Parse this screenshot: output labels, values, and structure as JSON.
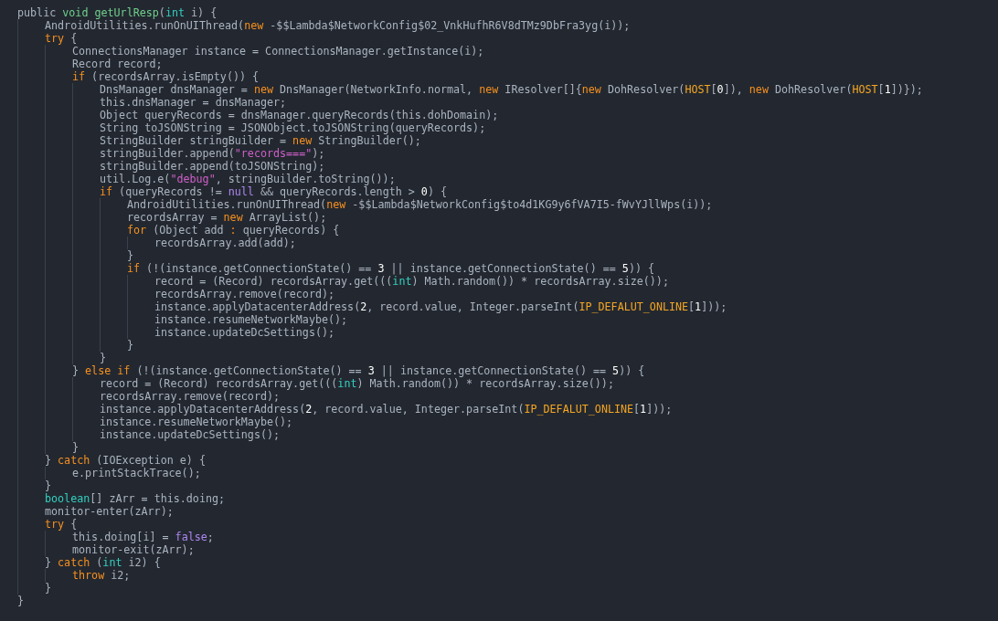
{
  "editor": {
    "lines": [
      {
        "tokens": [
          {
            "kind": "plain",
            "text": "public "
          },
          {
            "kind": "function",
            "text": "void getUrlResp"
          },
          {
            "kind": "plain",
            "text": "("
          },
          {
            "kind": "type",
            "text": "int"
          },
          {
            "kind": "plain",
            "text": " i) {"
          }
        ],
        "children": [
          {
            "tokens": [
              {
                "kind": "plain",
                "text": "AndroidUtilities.runOnUIThread("
              },
              {
                "kind": "keyword",
                "text": "new"
              },
              {
                "kind": "plain",
                "text": " -$$Lambda$NetworkConfig$02_VnkHufhR6V8dTMz9DbFra3yg(i));"
              }
            ]
          },
          {
            "tokens": [
              {
                "kind": "keyword",
                "text": "try"
              },
              {
                "kind": "plain",
                "text": " {"
              }
            ],
            "children": [
              {
                "tokens": [
                  {
                    "kind": "plain",
                    "text": "ConnectionsManager instance = ConnectionsManager.getInstance(i);"
                  }
                ]
              },
              {
                "tokens": [
                  {
                    "kind": "plain",
                    "text": "Record record;"
                  }
                ]
              },
              {
                "tokens": [
                  {
                    "kind": "keyword",
                    "text": "if"
                  },
                  {
                    "kind": "plain",
                    "text": " (recordsArray.isEmpty()) {"
                  }
                ],
                "children": [
                  {
                    "tokens": [
                      {
                        "kind": "plain",
                        "text": "DnsManager dnsManager = "
                      },
                      {
                        "kind": "keyword",
                        "text": "new"
                      },
                      {
                        "kind": "plain",
                        "text": " DnsManager(NetworkInfo.normal, "
                      },
                      {
                        "kind": "keyword",
                        "text": "new"
                      },
                      {
                        "kind": "plain",
                        "text": " IResolver[]{"
                      },
                      {
                        "kind": "keyword",
                        "text": "new"
                      },
                      {
                        "kind": "plain",
                        "text": " DohResolver("
                      },
                      {
                        "kind": "constant",
                        "text": "HOST"
                      },
                      {
                        "kind": "plain",
                        "text": "["
                      },
                      {
                        "kind": "number",
                        "text": "0"
                      },
                      {
                        "kind": "plain",
                        "text": "]), "
                      },
                      {
                        "kind": "keyword",
                        "text": "new"
                      },
                      {
                        "kind": "plain",
                        "text": " DohResolver("
                      },
                      {
                        "kind": "constant",
                        "text": "HOST"
                      },
                      {
                        "kind": "plain",
                        "text": "["
                      },
                      {
                        "kind": "number",
                        "text": "1"
                      },
                      {
                        "kind": "plain",
                        "text": "])});"
                      }
                    ]
                  },
                  {
                    "tokens": [
                      {
                        "kind": "plain",
                        "text": "this.dnsManager = dnsManager;"
                      }
                    ]
                  },
                  {
                    "tokens": [
                      {
                        "kind": "plain",
                        "text": "Object queryRecords = dnsManager.queryRecords(this.dohDomain);"
                      }
                    ]
                  },
                  {
                    "tokens": [
                      {
                        "kind": "plain",
                        "text": "String toJSONString = JSONObject.toJSONString(queryRecords);"
                      }
                    ]
                  },
                  {
                    "tokens": [
                      {
                        "kind": "plain",
                        "text": "StringBuilder stringBuilder = "
                      },
                      {
                        "kind": "keyword",
                        "text": "new"
                      },
                      {
                        "kind": "plain",
                        "text": " StringBuilder();"
                      }
                    ]
                  },
                  {
                    "tokens": [
                      {
                        "kind": "plain",
                        "text": "stringBuilder.append("
                      },
                      {
                        "kind": "string",
                        "text": "\"records===\""
                      },
                      {
                        "kind": "plain",
                        "text": ");"
                      }
                    ]
                  },
                  {
                    "tokens": [
                      {
                        "kind": "plain",
                        "text": "stringBuilder.append(toJSONString);"
                      }
                    ]
                  },
                  {
                    "tokens": [
                      {
                        "kind": "plain",
                        "text": "util.Log.e("
                      },
                      {
                        "kind": "string",
                        "text": "\"debug\""
                      },
                      {
                        "kind": "plain",
                        "text": ", stringBuilder.toString());"
                      }
                    ]
                  },
                  {
                    "tokens": [
                      {
                        "kind": "keyword",
                        "text": "if"
                      },
                      {
                        "kind": "plain",
                        "text": " (queryRecords != "
                      },
                      {
                        "kind": "literal",
                        "text": "null"
                      },
                      {
                        "kind": "plain",
                        "text": " && queryRecords.length > "
                      },
                      {
                        "kind": "number",
                        "text": "0"
                      },
                      {
                        "kind": "plain",
                        "text": ") {"
                      }
                    ],
                    "children": [
                      {
                        "tokens": [
                          {
                            "kind": "plain",
                            "text": "AndroidUtilities.runOnUIThread("
                          },
                          {
                            "kind": "keyword",
                            "text": "new"
                          },
                          {
                            "kind": "plain",
                            "text": " -$$Lambda$NetworkConfig$to4d1KG9y6fVA7I5-fWvYJllWps(i));"
                          }
                        ]
                      },
                      {
                        "tokens": [
                          {
                            "kind": "plain",
                            "text": "recordsArray = "
                          },
                          {
                            "kind": "keyword",
                            "text": "new"
                          },
                          {
                            "kind": "plain",
                            "text": " ArrayList();"
                          }
                        ]
                      },
                      {
                        "tokens": [
                          {
                            "kind": "keyword",
                            "text": "for"
                          },
                          {
                            "kind": "plain",
                            "text": " (Object add "
                          },
                          {
                            "kind": "keyword",
                            "text": ":"
                          },
                          {
                            "kind": "plain",
                            "text": " queryRecords) {"
                          }
                        ],
                        "children": [
                          {
                            "tokens": [
                              {
                                "kind": "plain",
                                "text": "recordsArray.add(add);"
                              }
                            ]
                          }
                        ]
                      },
                      {
                        "tokens": [
                          {
                            "kind": "plain",
                            "text": "}"
                          }
                        ]
                      },
                      {
                        "tokens": [
                          {
                            "kind": "keyword",
                            "text": "if"
                          },
                          {
                            "kind": "plain",
                            "text": " (!(instance.getConnectionState() == "
                          },
                          {
                            "kind": "number",
                            "text": "3"
                          },
                          {
                            "kind": "plain",
                            "text": " || instance.getConnectionState() == "
                          },
                          {
                            "kind": "number",
                            "text": "5"
                          },
                          {
                            "kind": "plain",
                            "text": ")) {"
                          }
                        ],
                        "children": [
                          {
                            "tokens": [
                              {
                                "kind": "plain",
                                "text": "record = (Record) recordsArray.get((("
                              },
                              {
                                "kind": "type",
                                "text": "int"
                              },
                              {
                                "kind": "plain",
                                "text": ") Math.random()) * recordsArray.size());"
                              }
                            ]
                          },
                          {
                            "tokens": [
                              {
                                "kind": "plain",
                                "text": "recordsArray.remove(record);"
                              }
                            ]
                          },
                          {
                            "tokens": [
                              {
                                "kind": "plain",
                                "text": "instance.applyDatacenterAddress("
                              },
                              {
                                "kind": "number",
                                "text": "2"
                              },
                              {
                                "kind": "plain",
                                "text": ", record.value, Integer.parseInt("
                              },
                              {
                                "kind": "constant",
                                "text": "IP_DEFALUT_ONLINE"
                              },
                              {
                                "kind": "plain",
                                "text": "["
                              },
                              {
                                "kind": "number",
                                "text": "1"
                              },
                              {
                                "kind": "plain",
                                "text": "]));"
                              }
                            ]
                          },
                          {
                            "tokens": [
                              {
                                "kind": "plain",
                                "text": "instance.resumeNetworkMaybe();"
                              }
                            ]
                          },
                          {
                            "tokens": [
                              {
                                "kind": "plain",
                                "text": "instance.updateDcSettings();"
                              }
                            ]
                          }
                        ]
                      },
                      {
                        "tokens": [
                          {
                            "kind": "plain",
                            "text": "}"
                          }
                        ]
                      }
                    ]
                  },
                  {
                    "tokens": [
                      {
                        "kind": "plain",
                        "text": "}"
                      }
                    ]
                  }
                ]
              },
              {
                "tokens": [
                  {
                    "kind": "plain",
                    "text": "} "
                  },
                  {
                    "kind": "keyword",
                    "text": "else if"
                  },
                  {
                    "kind": "plain",
                    "text": " (!(instance.getConnectionState() == "
                  },
                  {
                    "kind": "number",
                    "text": "3"
                  },
                  {
                    "kind": "plain",
                    "text": " || instance.getConnectionState() == "
                  },
                  {
                    "kind": "number",
                    "text": "5"
                  },
                  {
                    "kind": "plain",
                    "text": ")) {"
                  }
                ],
                "children": [
                  {
                    "tokens": [
                      {
                        "kind": "plain",
                        "text": "record = (Record) recordsArray.get((("
                      },
                      {
                        "kind": "type",
                        "text": "int"
                      },
                      {
                        "kind": "plain",
                        "text": ") Math.random()) * recordsArray.size());"
                      }
                    ]
                  },
                  {
                    "tokens": [
                      {
                        "kind": "plain",
                        "text": "recordsArray.remove(record);"
                      }
                    ]
                  },
                  {
                    "tokens": [
                      {
                        "kind": "plain",
                        "text": "instance.applyDatacenterAddress("
                      },
                      {
                        "kind": "number",
                        "text": "2"
                      },
                      {
                        "kind": "plain",
                        "text": ", record.value, Integer.parseInt("
                      },
                      {
                        "kind": "constant",
                        "text": "IP_DEFALUT_ONLINE"
                      },
                      {
                        "kind": "plain",
                        "text": "["
                      },
                      {
                        "kind": "number",
                        "text": "1"
                      },
                      {
                        "kind": "plain",
                        "text": "]));"
                      }
                    ]
                  },
                  {
                    "tokens": [
                      {
                        "kind": "plain",
                        "text": "instance.resumeNetworkMaybe();"
                      }
                    ]
                  },
                  {
                    "tokens": [
                      {
                        "kind": "plain",
                        "text": "instance.updateDcSettings();"
                      }
                    ]
                  }
                ]
              },
              {
                "tokens": [
                  {
                    "kind": "plain",
                    "text": "}"
                  }
                ]
              }
            ]
          },
          {
            "tokens": [
              {
                "kind": "plain",
                "text": "} "
              },
              {
                "kind": "keyword",
                "text": "catch"
              },
              {
                "kind": "plain",
                "text": " (IOException e) {"
              }
            ],
            "children": [
              {
                "tokens": [
                  {
                    "kind": "plain",
                    "text": "e.printStackTrace();"
                  }
                ]
              }
            ]
          },
          {
            "tokens": [
              {
                "kind": "plain",
                "text": "}"
              }
            ]
          },
          {
            "tokens": [
              {
                "kind": "type",
                "text": "boolean"
              },
              {
                "kind": "plain",
                "text": "[] zArr = this.doing;"
              }
            ]
          },
          {
            "tokens": [
              {
                "kind": "plain",
                "text": "monitor-enter(zArr);"
              }
            ]
          },
          {
            "tokens": [
              {
                "kind": "keyword",
                "text": "try"
              },
              {
                "kind": "plain",
                "text": " {"
              }
            ],
            "children": [
              {
                "tokens": [
                  {
                    "kind": "plain",
                    "text": "this.doing[i] = "
                  },
                  {
                    "kind": "literal",
                    "text": "false"
                  },
                  {
                    "kind": "plain",
                    "text": ";"
                  }
                ]
              },
              {
                "tokens": [
                  {
                    "kind": "plain",
                    "text": "monitor-exit(zArr);"
                  }
                ]
              }
            ]
          },
          {
            "tokens": [
              {
                "kind": "plain",
                "text": "} "
              },
              {
                "kind": "keyword",
                "text": "catch"
              },
              {
                "kind": "plain",
                "text": " ("
              },
              {
                "kind": "type",
                "text": "int"
              },
              {
                "kind": "plain",
                "text": " i2) {"
              }
            ],
            "children": [
              {
                "tokens": [
                  {
                    "kind": "keyword",
                    "text": "throw"
                  },
                  {
                    "kind": "plain",
                    "text": " i2;"
                  }
                ]
              }
            ]
          },
          {
            "tokens": [
              {
                "kind": "plain",
                "text": "}"
              }
            ]
          }
        ]
      },
      {
        "tokens": [
          {
            "kind": "plain",
            "text": "}"
          }
        ]
      }
    ]
  }
}
